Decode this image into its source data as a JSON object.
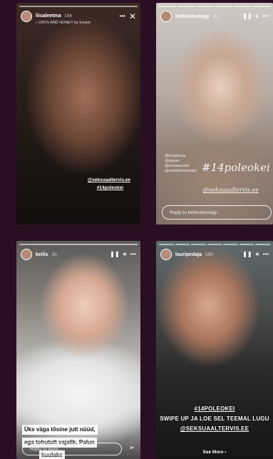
{
  "stories": [
    {
      "username": "liisaleetma",
      "time": "15h",
      "music": "♪ OATS AND HONEY by bryant",
      "tag1": "@seksuaaltervis.ee",
      "tag2": "#14poleokei"
    },
    {
      "username": "kethiuibomagi",
      "time": "2h",
      "hashtag": "#14poleokei",
      "mention": "@seksuaaltervis.ee",
      "small_mentions": [
        "@lindajerova",
        "@kippam",
        "@kristelaaslaid",
        "@madelinmoonstad"
      ],
      "reply_placeholder": "Reply to kethiuibomagi..."
    },
    {
      "username": "keilis",
      "time": "2h",
      "caption_lines": [
        "Üks väga tõsine jutt nüüd,",
        "aga tohutult vajalik. Palun",
        "kuulake"
      ],
      "reply_placeholder": "Reply to keilis..."
    },
    {
      "username": "lauripedaja",
      "time": "10h",
      "text1": "#14POLEOKEI",
      "text2": "SWIPE UP JA LOE SEL TEEMAL LUGU",
      "text3": "@SEKSUAALTERVIS.EE",
      "see_more": "See More"
    }
  ],
  "icons": {
    "more": "more-icon",
    "close": "close-icon",
    "pause": "pause-icon",
    "mute": "mute-icon",
    "sound": "sound-icon",
    "send": "send-icon"
  }
}
